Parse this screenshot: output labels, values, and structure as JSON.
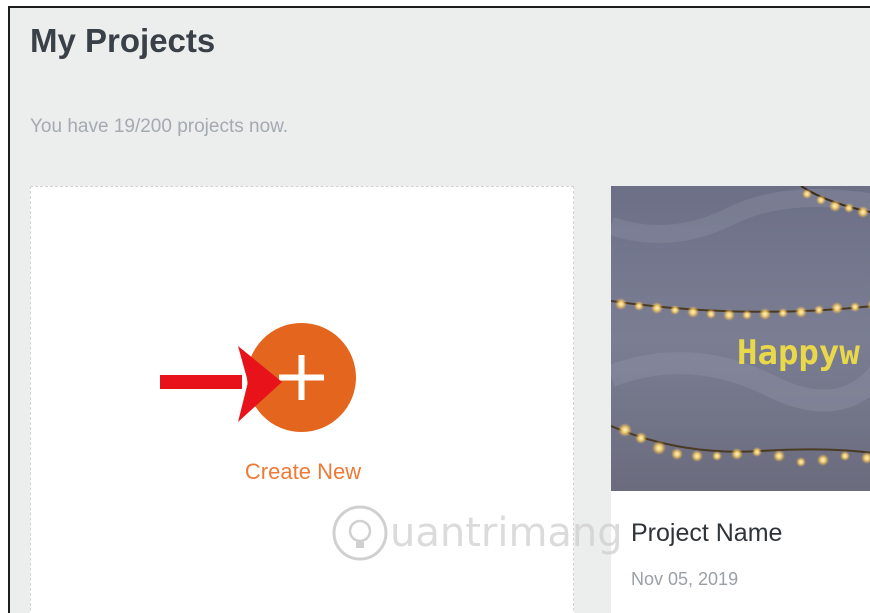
{
  "page": {
    "title": "My Projects",
    "subtitle": "You have 19/200 projects now."
  },
  "create_card": {
    "label": "Create New",
    "icon": "plus-icon"
  },
  "projects": [
    {
      "name": "Project Name",
      "date": "Nov 05, 2019",
      "thumbnail_text": "Happyw"
    }
  ],
  "colors": {
    "accent": "#e4651d",
    "accent_text": "#ef7a37",
    "arrow": "#e8121b",
    "background": "#eceded"
  },
  "watermark": {
    "text": "uantrimang"
  }
}
